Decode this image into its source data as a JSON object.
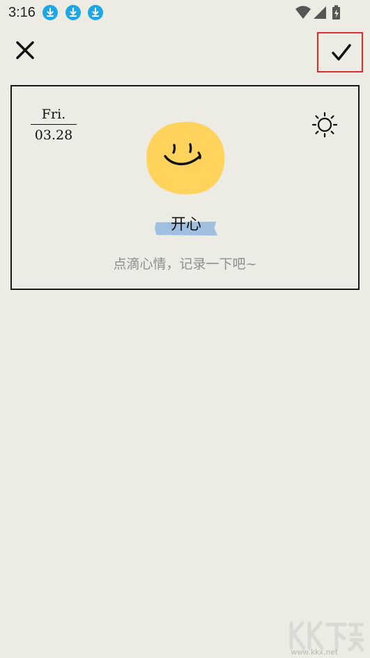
{
  "status_bar": {
    "time": "3:16",
    "notification_icons": [
      "download-icon",
      "download-icon",
      "download-icon"
    ],
    "system_icons": [
      "wifi-icon",
      "signal-icon",
      "battery-charging-icon"
    ]
  },
  "toolbar": {
    "close_icon": "close-icon",
    "confirm_icon": "check-icon",
    "confirm_highlight_color": "#e02b2b"
  },
  "card": {
    "day_of_week": "Fri.",
    "date": "03.28",
    "weather_icon": "sun-icon",
    "mood_icon": "smiley-face-icon",
    "mood_label": "开心",
    "mood_color": "#ffd35c",
    "label_tape_color": "#9ebfe0",
    "note_placeholder": "点滴心情，记录一下吧~"
  },
  "watermark": {
    "logo_text": "KK下载",
    "url": "www.kkx.net"
  },
  "colors": {
    "background": "#ecebe4",
    "accent_blue": "#1ea7e6"
  }
}
